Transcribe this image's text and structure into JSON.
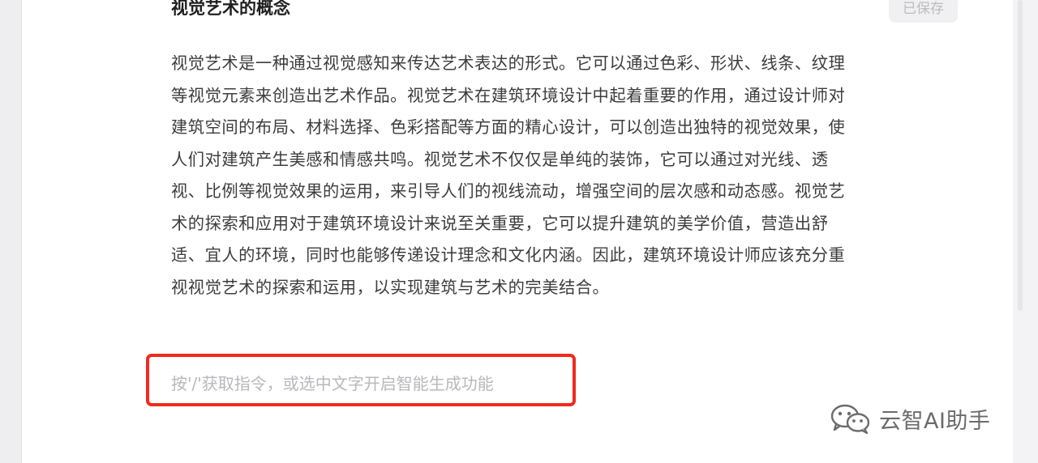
{
  "document": {
    "title": "视觉艺术的概念",
    "save_status": "已保存",
    "paragraph": "视觉艺术是一种通过视觉感知来传达艺术表达的形式。它可以通过色彩、形状、线条、纹理等视觉元素来创造出艺术作品。视觉艺术在建筑环境设计中起着重要的作用，通过设计师对建筑空间的布局、材料选择、色彩搭配等方面的精心设计，可以创造出独特的视觉效果，使人们对建筑产生美感和情感共鸣。视觉艺术不仅仅是单纯的装饰，它可以通过对光线、透视、比例等视觉效果的运用，来引导人们的视线流动，增强空间的层次感和动态感。视觉艺术的探索和应用对于建筑环境设计来说至关重要，它可以提升建筑的美学价值，营造出舒适、宜人的环境，同时也能够传递设计理念和文化内涵。因此，建筑环境设计师应该充分重视视觉艺术的探索和运用，以实现建筑与艺术的完美结合。",
    "command_placeholder": "按'/'获取指令，或选中文字开启智能生成功能"
  },
  "highlight": {
    "color": "#f02a1e"
  },
  "watermark": {
    "icon": "wechat-icon",
    "text": "云智AI助手"
  }
}
